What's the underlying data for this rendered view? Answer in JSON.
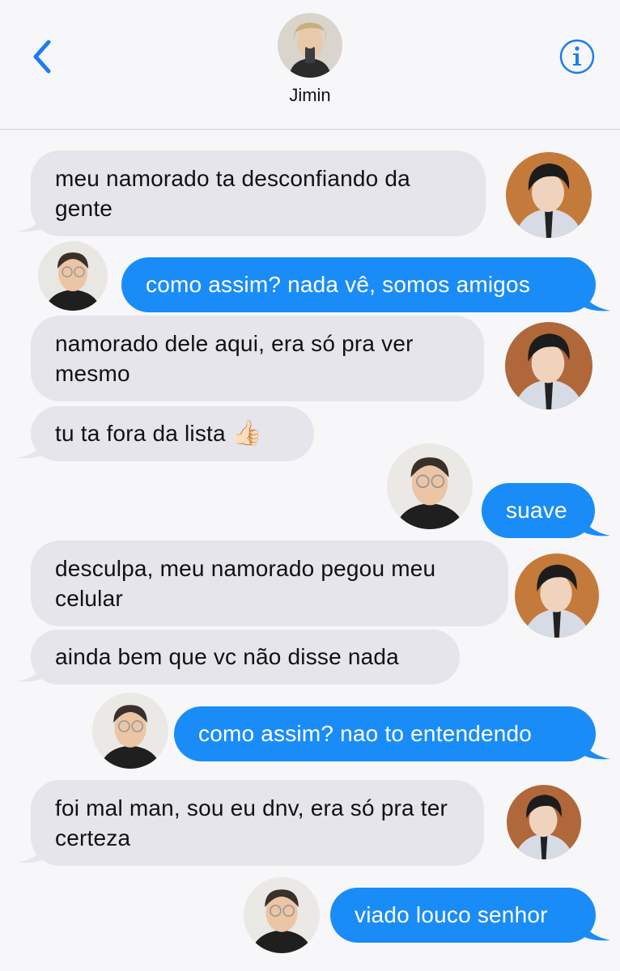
{
  "header": {
    "contact_name": "Jimin"
  },
  "icons": {
    "back": "chevron-left-icon",
    "info": "info-circle-icon"
  },
  "colors": {
    "incoming_bubble": "#e6e5eb",
    "outgoing_bubble": "#1a8cf7",
    "accent": "#1a7df3",
    "background": "#f7f7f9"
  },
  "messages": [
    {
      "direction": "incoming",
      "text": "meu namorado ta desconfiando da gente"
    },
    {
      "direction": "outgoing",
      "text": "como assim? nada vê, somos amigos"
    },
    {
      "direction": "incoming",
      "text": "namorado dele aqui, era só pra ver mesmo"
    },
    {
      "direction": "incoming",
      "text": "tu ta fora da lista",
      "emoji": "👍🏻"
    },
    {
      "direction": "outgoing",
      "text": "suave"
    },
    {
      "direction": "incoming",
      "text": "desculpa, meu namorado pegou meu celular"
    },
    {
      "direction": "incoming",
      "text": "ainda bem que vc não disse nada"
    },
    {
      "direction": "outgoing",
      "text": "como assim? nao to entendendo"
    },
    {
      "direction": "incoming",
      "text": "foi mal man, sou eu dnv, era só pra ter certeza"
    },
    {
      "direction": "outgoing",
      "text": "viado louco senhor"
    }
  ]
}
